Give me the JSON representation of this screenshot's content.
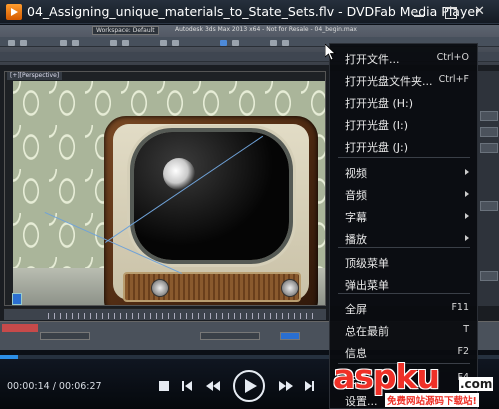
{
  "window": {
    "title": "04_Assigning_unique_materials_to_State_Sets.flv - DVDFab Media Player"
  },
  "video_frame": {
    "viewport_label": "[+][Perspective]",
    "max_tab": "Workspace: Default",
    "max_caption": "Autodesk 3ds Max 2013 x64 - Not for Resale - 04_begin.max"
  },
  "playback": {
    "elapsed": "00:00:14",
    "total": "00:06:27",
    "time_separator": " / ",
    "progress_fraction": 0.037
  },
  "context_menu": {
    "items": [
      {
        "label": "打开文件...",
        "shortcut": "Ctrl+O",
        "submenu": false
      },
      {
        "label": "打开光盘文件夹...",
        "shortcut": "Ctrl+F",
        "submenu": false
      },
      {
        "label": "打开光盘 (H:)",
        "shortcut": "",
        "submenu": false
      },
      {
        "label": "打开光盘 (I:)",
        "shortcut": "",
        "submenu": false
      },
      {
        "label": "打开光盘 (J:)",
        "shortcut": "",
        "submenu": false
      },
      {
        "label": "视频",
        "shortcut": "",
        "submenu": true
      },
      {
        "label": "音频",
        "shortcut": "",
        "submenu": true
      },
      {
        "label": "字幕",
        "shortcut": "",
        "submenu": true
      },
      {
        "label": "播放",
        "shortcut": "",
        "submenu": true
      },
      {
        "label": "顶级菜单",
        "shortcut": "",
        "submenu": false
      },
      {
        "label": "弹出菜单",
        "shortcut": "",
        "submenu": false
      },
      {
        "label": "全屏",
        "shortcut": "F11",
        "submenu": false
      },
      {
        "label": "总在最前",
        "shortcut": "T",
        "submenu": false
      },
      {
        "label": "信息",
        "shortcut": "F2",
        "submenu": false
      },
      {
        "label": "关于",
        "shortcut": "F4",
        "submenu": false
      },
      {
        "label": "设置...",
        "shortcut": "",
        "submenu": false
      }
    ]
  },
  "watermark": {
    "logo": "aspku",
    "suffix": ".com",
    "tagline": "免费网站源码下载站!"
  },
  "icons": {
    "app": "dvdfab-player-icon",
    "minimize": "minimize-icon",
    "maximize": "maximize-icon",
    "close": "close-icon",
    "stop": "stop-icon",
    "previous": "previous-icon",
    "rewind": "rewind-icon",
    "play": "play-icon",
    "forward": "fast-forward-icon",
    "next": "next-icon"
  },
  "colors": {
    "accent": "#2c8ee6",
    "watermark_red": "#ef3027",
    "menu_bg": "#0a0c10"
  }
}
